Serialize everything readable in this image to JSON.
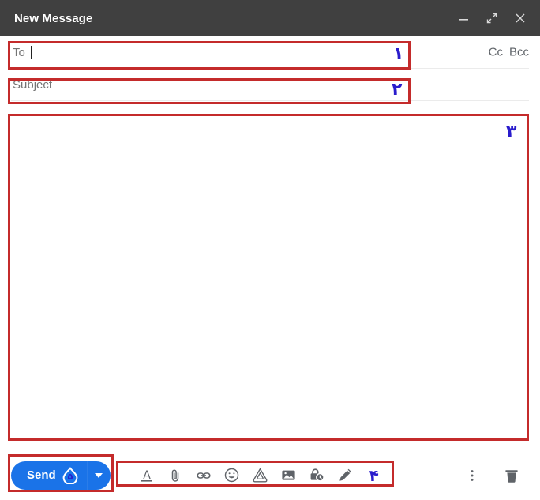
{
  "window": {
    "title": "New Message",
    "controls": [
      {
        "name": "minimize-icon",
        "label": "—"
      },
      {
        "name": "expand-icon",
        "label": "⤢"
      },
      {
        "name": "close-icon",
        "label": "×"
      }
    ]
  },
  "fields": {
    "to": {
      "label": "To",
      "value": "",
      "placeholder": "To"
    },
    "cc": {
      "label": "Cc"
    },
    "bcc": {
      "label": "Bcc"
    },
    "subject": {
      "label": "Subject",
      "value": "",
      "placeholder": "Subject"
    },
    "body": {
      "value": "",
      "placeholder": ""
    }
  },
  "send": {
    "label": "Send",
    "marker": "۵",
    "dropdown": "send-options"
  },
  "toolbar": [
    {
      "name": "formatting-options-icon",
      "title": "Formatting options"
    },
    {
      "name": "attach-file-icon",
      "title": "Attach files"
    },
    {
      "name": "insert-link-icon",
      "title": "Insert link"
    },
    {
      "name": "insert-emoji-icon",
      "title": "Insert emoji"
    },
    {
      "name": "insert-drive-file-icon",
      "title": "Insert files using Drive"
    },
    {
      "name": "insert-photo-icon",
      "title": "Insert photo"
    },
    {
      "name": "confidential-mode-icon",
      "title": "Toggle confidential mode"
    },
    {
      "name": "insert-signature-icon",
      "title": "Insert signature"
    }
  ],
  "right_tools": [
    {
      "name": "more-options-icon",
      "title": "More options"
    },
    {
      "name": "discard-draft-icon",
      "title": "Discard draft"
    }
  ],
  "annotations": [
    {
      "id": "1",
      "numeral": "۱",
      "target": "to-field"
    },
    {
      "id": "2",
      "numeral": "۲",
      "target": "subject-field"
    },
    {
      "id": "3",
      "numeral": "۳",
      "target": "body-field"
    },
    {
      "id": "4",
      "numeral": "۴",
      "target": "toolbar"
    },
    {
      "id": "5",
      "numeral": "۵",
      "target": "send-button"
    }
  ],
  "colors": {
    "titlebar": "#404040",
    "accent": "#1a73e8",
    "annotation_box": "#c42b2b",
    "annotation_text": "#2a1ccc",
    "placeholder": "#747474"
  }
}
